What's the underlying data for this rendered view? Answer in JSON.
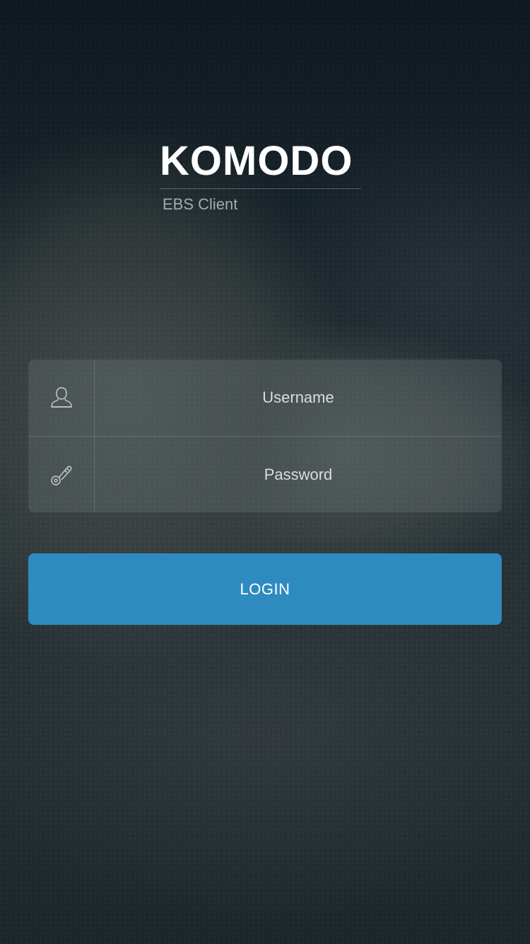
{
  "app": {
    "title": "KOMODO",
    "subtitle": "EBS Client"
  },
  "form": {
    "username_placeholder": "Username",
    "password_placeholder": "Password",
    "username_icon": "user-icon",
    "password_icon": "key-icon",
    "login_label": "LOGIN"
  },
  "colors": {
    "accent": "#2e8bc0",
    "title": "#ffffff",
    "subtitle": "#a3abae"
  }
}
